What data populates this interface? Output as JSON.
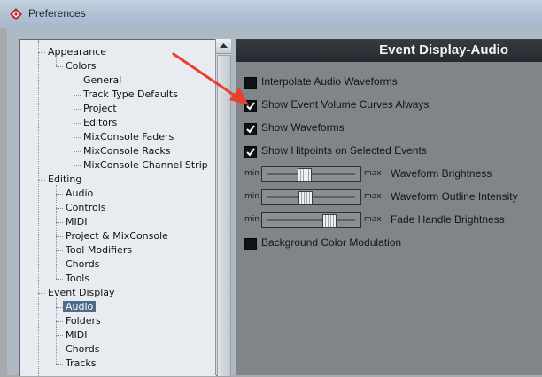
{
  "window": {
    "title": "Preferences"
  },
  "tree": {
    "items": [
      {
        "label": "Appearance",
        "level": 0,
        "selected": false
      },
      {
        "label": "Colors",
        "level": 1,
        "selected": false
      },
      {
        "label": "General",
        "level": 2,
        "selected": false
      },
      {
        "label": "Track Type Defaults",
        "level": 2,
        "selected": false
      },
      {
        "label": "Project",
        "level": 2,
        "selected": false
      },
      {
        "label": "Editors",
        "level": 2,
        "selected": false
      },
      {
        "label": "MixConsole Faders",
        "level": 2,
        "selected": false
      },
      {
        "label": "MixConsole Racks",
        "level": 2,
        "selected": false
      },
      {
        "label": "MixConsole Channel Strip",
        "level": 2,
        "selected": false
      },
      {
        "label": "Editing",
        "level": 0,
        "selected": false
      },
      {
        "label": "Audio",
        "level": 1,
        "selected": false
      },
      {
        "label": "Controls",
        "level": 1,
        "selected": false
      },
      {
        "label": "MIDI",
        "level": 1,
        "selected": false
      },
      {
        "label": "Project & MixConsole",
        "level": 1,
        "selected": false
      },
      {
        "label": "Tool Modifiers",
        "level": 1,
        "selected": false
      },
      {
        "label": "Chords",
        "level": 1,
        "selected": false
      },
      {
        "label": "Tools",
        "level": 1,
        "selected": false
      },
      {
        "label": "Event Display",
        "level": 0,
        "selected": false
      },
      {
        "label": "Audio",
        "level": 1,
        "selected": true
      },
      {
        "label": "Folders",
        "level": 1,
        "selected": false
      },
      {
        "label": "MIDI",
        "level": 1,
        "selected": false
      },
      {
        "label": "Chords",
        "level": 1,
        "selected": false
      },
      {
        "label": "Tracks",
        "level": 1,
        "selected": false
      }
    ]
  },
  "panel": {
    "title": "Event Display-Audio",
    "options": [
      {
        "label": "Interpolate Audio Waveforms",
        "checked": false
      },
      {
        "label": "Show Event Volume Curves Always",
        "checked": true
      },
      {
        "label": "Show Waveforms",
        "checked": true
      },
      {
        "label": "Show Hitpoints on Selected Events",
        "checked": true
      }
    ],
    "sliders": [
      {
        "label": "Waveform Brightness",
        "min_label": "min",
        "max_label": "max",
        "value": 0.42
      },
      {
        "label": "Waveform Outline Intensity",
        "min_label": "min",
        "max_label": "max",
        "value": 0.43
      },
      {
        "label": "Fade Handle Brightness",
        "min_label": "min",
        "max_label": "max",
        "value": 0.72
      }
    ],
    "extra_option": {
      "label": "Background Color Modulation",
      "checked": false
    }
  },
  "colors": {
    "annotation_arrow": "#e8402b",
    "header_bg": "#2b3035",
    "selection": "#4d6c8c"
  },
  "icons": {
    "app": "cubase-logo-icon",
    "check": "checkmark-icon",
    "scroll_up": "arrow-up-icon"
  }
}
